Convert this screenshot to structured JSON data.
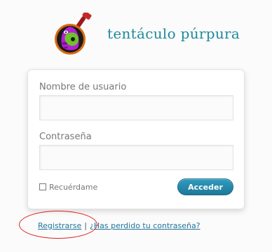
{
  "site": {
    "title": "tentáculo púrpura"
  },
  "login_form": {
    "username_label": "Nombre de usuario",
    "username_value": "",
    "password_label": "Contraseña",
    "password_value": "",
    "remember_label": "Recuérdame",
    "remember_checked": false,
    "submit_label": "Acceder"
  },
  "nav": {
    "register_label": "Registrarse",
    "separator": "|",
    "lost_password_label": "¿Has perdido tu contraseña?"
  },
  "colors": {
    "title": "#1f8a9b",
    "link": "#21759b",
    "button": "#2488ab",
    "annotation": "#e02020"
  },
  "icons": {
    "logo": "purple-tentacle-guitar-logo"
  }
}
